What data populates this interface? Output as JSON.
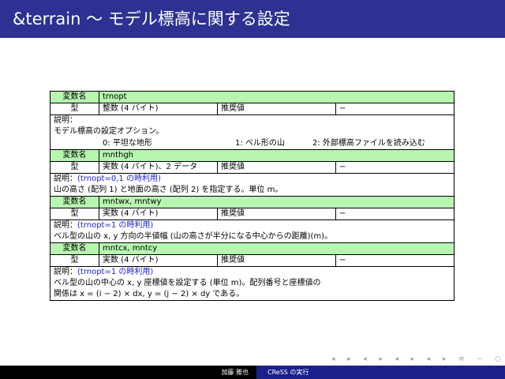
{
  "slide_title": "&terrain ～ モデル標高に関する設定",
  "labels": {
    "var_name": "変数名",
    "type": "型",
    "recommended": "推奨値",
    "description": "説明："
  },
  "blocks": [
    {
      "name": "trnopt",
      "type": "整数 (4 バイト)",
      "recommended": "−",
      "description_note": "",
      "description_lines": [
        "モデル標高の設定オプション。"
      ],
      "options": [
        "0: 平坦な地形",
        "1: ベル形の山",
        "2: 外部標高ファイルを読み込む"
      ]
    },
    {
      "name": "mnthgh",
      "type": "実数 (4 バイト)、2 データ",
      "recommended": "−",
      "description_note": "(trnopt=0,1 の時利用)",
      "description_lines": [
        "山の高さ (配列 1) と地面の高さ (配列 2) を指定する。単位 m。"
      ]
    },
    {
      "name": "mntwx, mntwy",
      "type": "実数 (4 バイト)",
      "recommended": "−",
      "description_note": "(trnopt=1 の時利用)",
      "description_lines": [
        "ベル型の山の x, y 方向の半値幅 (山の高さが半分になる中心からの距離)(m)。"
      ]
    },
    {
      "name": "mntcx, mntcy",
      "type": "実数 (4 バイト)",
      "recommended": "−",
      "description_note": "(trnopt=1 の時利用)",
      "description_lines": [
        "ベル型の山の中心の x, y 座標値を設定する (単位 m)。配列番号と座標値の",
        "関係は x = (i − 2) × dx, y = (j − 2) × dy である。"
      ]
    }
  ],
  "footer": {
    "author": "加藤 雅也",
    "talk": "CReSS の実行"
  },
  "nav_symbols": [
    "◂",
    "▸",
    "◂",
    "▸",
    "◂",
    "▸",
    "◂",
    "▸",
    "≡",
    "∽",
    "○"
  ],
  "colors": {
    "title_bar": "#2e3192",
    "header_row": "#b7f5b0",
    "note_text": "#1a1ad6",
    "footer_right": "#1b1f8c"
  }
}
